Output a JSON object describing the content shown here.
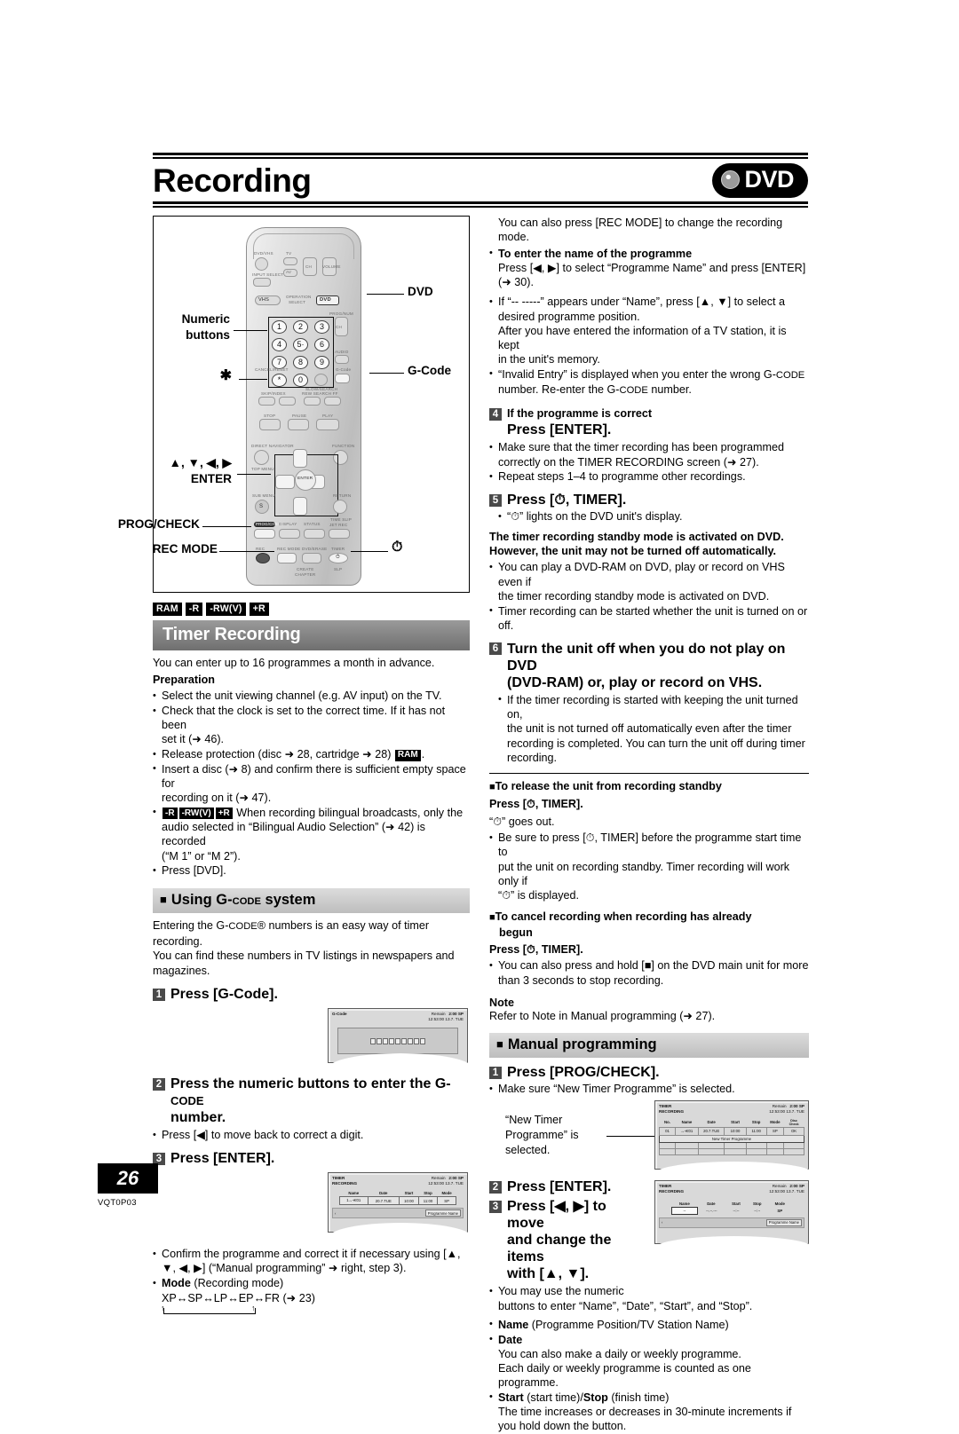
{
  "header": {
    "title": "Recording",
    "badge": "DVD",
    "badge_icon": "disc-icon"
  },
  "remote": {
    "callouts": {
      "dvd": "DVD",
      "gcode": "G-Code",
      "numeric": "Numeric\nbuttons",
      "numeric_l1": "Numeric",
      "numeric_l2": "buttons",
      "asterisk": "✱",
      "cursor_l1": "▲, ▼, ◀, ▶",
      "cursor_l2": "ENTER",
      "progcheck": "PROG/CHECK",
      "recmode": "REC MODE",
      "timer": "⏱"
    },
    "labels": {
      "dvd_vhs": "DVD/VHS",
      "tv": "TV",
      "input_select": "INPUT SELECT",
      "av": "AV",
      "ch": "CH",
      "volume": "VOLUME",
      "vhs": "VHS",
      "operation_select_1": "OPERATION",
      "operation_select_2": "SELECT",
      "dvd_key": "DVD",
      "prognum": "PROG/NUM",
      "audio": "AUDIO",
      "cancel_reset": "CANCEL/RESET",
      "gcode_key": "G-Code",
      "skip_index": "SKIP/INDEX",
      "scan_slow": "SLOW/SEARCH",
      "rew_search_ff": "REW SEARCH FF",
      "stop": "STOP",
      "pause": "PAUSE",
      "play": "PLAY",
      "direct_navigator": "DIRECT NAVIGATOR",
      "top_menu": "TOP MENU",
      "function": "FUNCTION",
      "enter": "ENTER",
      "sub_menu": "SUB MENU",
      "s_key": "S",
      "return": "RETURN",
      "time_slip": "TIME SLIP",
      "jet_rec": "JET REC",
      "progcheck_key": "PROG/CHECK",
      "display": "DISPLAY",
      "status": "STATUS",
      "rec": "REC",
      "recmode_key": "REC MODE",
      "dvd_erase": "DVD/ERASE",
      "create_chapter_1": "CREATE",
      "create_chapter_2": "CHAPTER",
      "timer_key": "TIMER",
      "slp": "SLP",
      "numbers": [
        "1",
        "2",
        "3",
        "4",
        "5",
        "6",
        "7",
        "8",
        "9",
        "0"
      ],
      "five_dot": "5·"
    }
  },
  "left": {
    "badges": [
      "RAM",
      "-R",
      "-RW(V)",
      "+R"
    ],
    "timer_recording": {
      "title": "Timer Recording",
      "intro": "You can enter up to 16 programmes a month in advance.",
      "preparation_heading": "Preparation",
      "preparation": [
        "Select the unit viewing channel (e.g. AV input) on the TV.",
        "Check that the clock is set to the correct time. If it has not been set, set it (➜ 46).",
        "Release protection (disc ➜ 28, cartridge ➜ 28) RAM.",
        "Insert a disc (➜ 8) and confirm there is sufficient empty space for recording on it (➜ 47).",
        "-R -RW(V) +R When recording bilingual broadcasts, only the audio selected in “Bilingual Audio Selection” (➜ 42) is recorded (“M 1” or “M 2”).",
        "Press [DVD]."
      ],
      "prep_2a": "Check that the clock is set to the correct time. If it has not been",
      "prep_2b": "set it (➜ 46).",
      "prep_3a": "Release protection (disc ➜ 28, cartridge ➜ 28) ",
      "prep_4a": "Insert a disc (➜ 8) and confirm there is sufficient empty space for",
      "prep_4b": "recording on it (➜ 47).",
      "prep_5a": "When recording bilingual broadcasts, only the",
      "prep_5b": "audio selected in “Bilingual Audio Selection” (➜ 42) is recorded",
      "prep_5c": "(“M 1” or “M 2”).",
      "prep_6": "Press [DVD].",
      "prep_1": "Select the unit viewing channel (e.g. AV input) on the TV."
    },
    "gcode_section": {
      "title_pre": "Using G-",
      "title_sc": "CODE",
      "title_post": " system",
      "intro_1": "Entering the G-",
      "intro_1sc": "CODE",
      "intro_1b": "® numbers is an easy way of timer recording.",
      "intro_2": "You can find these numbers in TV listings in newspapers and",
      "intro_3": "magazines.",
      "step1_num": "1",
      "step1": "Press [G-Code].",
      "step2_num": "2",
      "step2_a": "Press the numeric buttons to enter the G-",
      "step2_sc": "CODE",
      "step2_b": "number.",
      "step2_bullet": "Press [◀] to move back to correct a digit.",
      "step3_num": "3",
      "step3": "Press [ENTER].",
      "after_1a": "Confirm the programme and correct it if necessary using [▲,",
      "after_1b": "▼, ◀, ▶] (“Manual programming” ➜ right, step 3).",
      "after_2": "Mode",
      "after_2b": " (Recording mode)",
      "mode_cycle": "XP↔SP↔LP↔EP↔FR (➜ 23)"
    },
    "osd_gcode": {
      "title": "G-Code",
      "remain_label": "Remain",
      "remain_val": "2:00 SP",
      "clock": "12:53:00  13.7. TUE",
      "digits": 9
    },
    "osd_timer": {
      "title_1": "TIMER",
      "title_2": "RECORDING",
      "remain_label": "Remain",
      "remain_val": "2:00 SP",
      "clock": "12:53:00  13.7. TUE",
      "columns": [
        "Name",
        "Date",
        "Start",
        "Stop",
        "Mode"
      ],
      "row": [
        "1↔≪01",
        "20.7.TUE",
        "10:00",
        "11:00",
        "SP"
      ],
      "prog_name_btn": "Programme Name"
    }
  },
  "right": {
    "top": {
      "line1": "You can also press [REC MODE] to change the recording",
      "line2": "mode.",
      "b1_head": "To enter the name of the programme",
      "b1_l1": "Press [◀, ▶] to select “Programme Name” and press [ENTER]",
      "b1_l2": "(➜ 30).",
      "b2_l1": "If “-- -----” appears under “Name”, press [▲, ▼] to select a",
      "b2_l2": "desired programme position.",
      "b2_l3": "After you have entered the information of a TV station, it is kept",
      "b2_l4": "in the unit's memory.",
      "b3_l1": "“Invalid Entry” is displayed when you enter the wrong G-",
      "b3_sc": "CODE",
      "b3_l2": "number. Re-enter the G-",
      "b3_sc2": "CODE",
      "b3_l2b": " number."
    },
    "step4": {
      "num": "4",
      "head": "If the programme is correct",
      "action": "Press [ENTER].",
      "b1_l1": "Make sure that the timer recording has been programmed",
      "b1_l2": "correctly on the TIMER RECORDING screen (➜ 27).",
      "b2": "Repeat steps 1–4 to programme other recordings."
    },
    "step5": {
      "num": "5",
      "action": "Press [⏱, TIMER].",
      "b1": "“⏱” lights on the DVD unit's display.",
      "bold_1": "The timer recording standby mode is activated on DVD.",
      "bold_2": "However, the unit may not be turned off automatically.",
      "b2_l1": "You can play a DVD-RAM on DVD, play or record on VHS even if",
      "b2_l2": "the timer recording standby mode is activated on DVD.",
      "b3": "Timer recording can be started whether the unit is turned on or off."
    },
    "step6": {
      "num": "6",
      "head_l1": "Turn the unit off when you do not play on DVD",
      "head_l2": "(DVD-RAM) or, play or record on VHS.",
      "b1_l1": "If the timer recording is started with keeping the unit turned on,",
      "b1_l2": "the unit is not turned off automatically even after the timer",
      "b1_l3": "recording is completed. You can turn the unit off during timer",
      "b1_l4": "recording."
    },
    "release": {
      "head": "To release the unit from recording standby",
      "press": "Press [⏱, TIMER].",
      "goes_out": "“⏱” goes out.",
      "b1_l1": "Be sure to press [⏱, TIMER] before the programme start time to",
      "b1_l2": "put the unit on recording standby. Timer recording will work only if",
      "b1_l3": "“⏱” is displayed."
    },
    "cancel": {
      "head_l1": "To cancel recording when recording has already",
      "head_l2": "begun",
      "press": "Press [⏱, TIMER].",
      "b1_l1": "You can also press and hold [■] on the DVD main unit for more",
      "b1_l2": "than 3 seconds to stop recording."
    },
    "note": {
      "head": "Note",
      "body": "Refer to Note in Manual programming (➜ 27)."
    },
    "manual": {
      "title": "Manual programming",
      "step1_num": "1",
      "step1": "Press [PROG/CHECK].",
      "step1_b": "Make sure “New Timer Programme” is selected.",
      "callout_l1": "“New Timer",
      "callout_l2": "Programme” is",
      "callout_l3": "selected.",
      "step2_num": "2",
      "step2": "Press [ENTER].",
      "step3_num": "3",
      "step3_l1": "Press [◀, ▶] to move",
      "step3_l2": "and change the items",
      "step3_l3": "with [▲, ▼].",
      "b1_l1": "You may use the numeric",
      "b1_l2": "buttons to enter “Name”, “Date”, “Start”, and “Stop”.",
      "b2_bold": "Name",
      "b2_rest": " (Programme Position/TV Station Name)",
      "b3_bold": "Date",
      "b3_l1": "You can also make a daily or weekly programme.",
      "b3_l2": "Each daily or weekly programme is counted as one",
      "b3_l3": "programme.",
      "b4_bold1": "Start",
      "b4_mid": " (start time)/",
      "b4_bold2": "Stop",
      "b4_rest": " (finish time)",
      "b4_l1": "The time increases or decreases in 30-minute increments if",
      "b4_l2": "you hold down the button."
    },
    "osd_list": {
      "title_1": "TIMER",
      "title_2": "RECORDING",
      "remain_label": "Remain",
      "remain_val": "2:00 SP",
      "clock": "12:53:00  13.7. TUE",
      "columns": [
        "No.",
        "Name",
        "Date",
        "Start",
        "Stop",
        "Mode",
        "Disc Check"
      ],
      "disc_check_l1": "Disc",
      "disc_check_l2": "Check",
      "row": [
        "01",
        "↔≪01",
        "20.7.TUE",
        "10:00",
        "11:00",
        "SP",
        "OK"
      ],
      "new_row": "New Timer Programme"
    },
    "osd_edit": {
      "title_1": "TIMER",
      "title_2": "RECORDING",
      "remain_label": "Remain",
      "remain_val": "2:00 SP",
      "clock": "12:53:00  13.7. TUE",
      "columns": [
        "Name",
        "Date",
        "Start",
        "Stop",
        "Mode"
      ],
      "row": [
        "--",
        "--.--.---",
        "--:--",
        "--:--",
        "SP"
      ],
      "prog_name_btn": "Programme Name"
    }
  },
  "footer": {
    "page_number": "26",
    "doc_code": "VQT0P03"
  }
}
